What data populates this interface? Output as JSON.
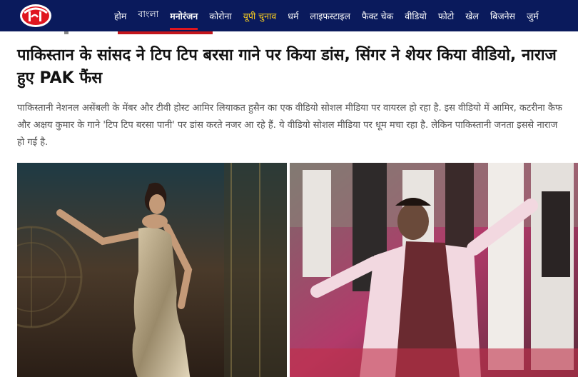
{
  "header": {
    "logo_alt": "आज तक",
    "nav": [
      {
        "label": "होम"
      },
      {
        "label": "বাংলা"
      },
      {
        "label": "मनोरंजन",
        "active": true
      },
      {
        "label": "कोरोना"
      },
      {
        "label": "यूपी चुनाव",
        "highlight": true
      },
      {
        "label": "धर्म"
      },
      {
        "label": "लाइफस्टाइल"
      },
      {
        "label": "फैक्ट चेक"
      },
      {
        "label": "वीडियो"
      },
      {
        "label": "फोटो"
      },
      {
        "label": "खेल"
      },
      {
        "label": "बिजनेस"
      },
      {
        "label": "जुर्म"
      }
    ]
  },
  "article": {
    "headline": "पाकिस्तान के सांसद ने टिप टिप बरसा गाने पर किया डांस, सिंगर ने शेयर किया वीडियो, नाराज हुए PAK फैंस",
    "summary": "पाकिस्तानी नेशनल असेंबली के मेंबर और टीवी होस्ट आमिर लियाकत हुसैन का एक वीडियो सोशल मीडिया पर वायरल हो रहा है. इस वीडियो में आमिर, कटरीना कैफ और अक्षय कुमार के गाने 'टिप टिप बरसा पानी' पर डांस करते नजर आ रहे हैं. ये वीडियो सोशल मीडिया पर धूम मचा रहा है. लेकिन पाकिस्तानी जनता इससे नाराज हो गई है."
  },
  "colors": {
    "nav_bg": "#0a1a5c",
    "accent_red": "#e0161f",
    "election_yellow": "#ffd21e"
  }
}
